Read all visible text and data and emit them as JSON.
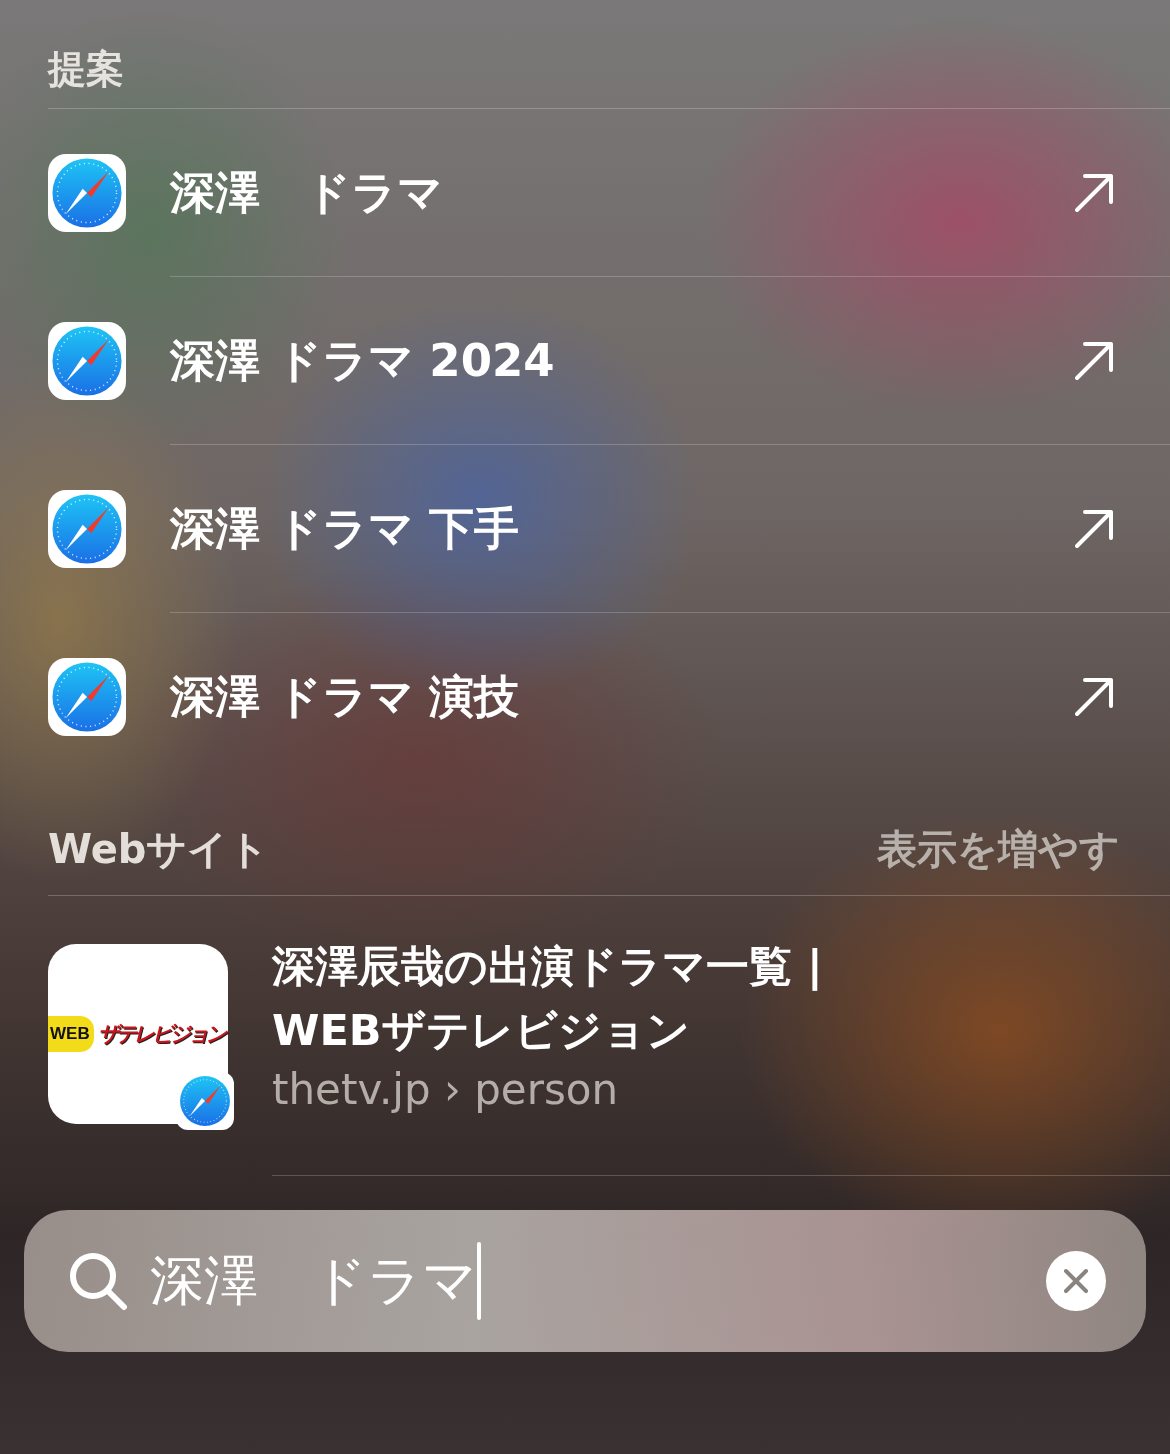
{
  "suggestions": {
    "title": "提案",
    "items": [
      {
        "text": "深澤　ドラマ"
      },
      {
        "text": "深澤 ドラマ 2024"
      },
      {
        "text": "深澤 ドラマ 下手"
      },
      {
        "text": "深澤 ドラマ 演技"
      }
    ]
  },
  "websites": {
    "title": "Webサイト",
    "more": "表示を増やす",
    "results": [
      {
        "title_lines": [
          "深澤辰哉の出演ドラマ一覧 |",
          "WEBザテレビジョン"
        ],
        "url": "thetv.jp › person",
        "logo_badge": "WEB",
        "logo_text": "ザテレビジョン"
      }
    ]
  },
  "search": {
    "value": "深澤　ドラマ"
  }
}
